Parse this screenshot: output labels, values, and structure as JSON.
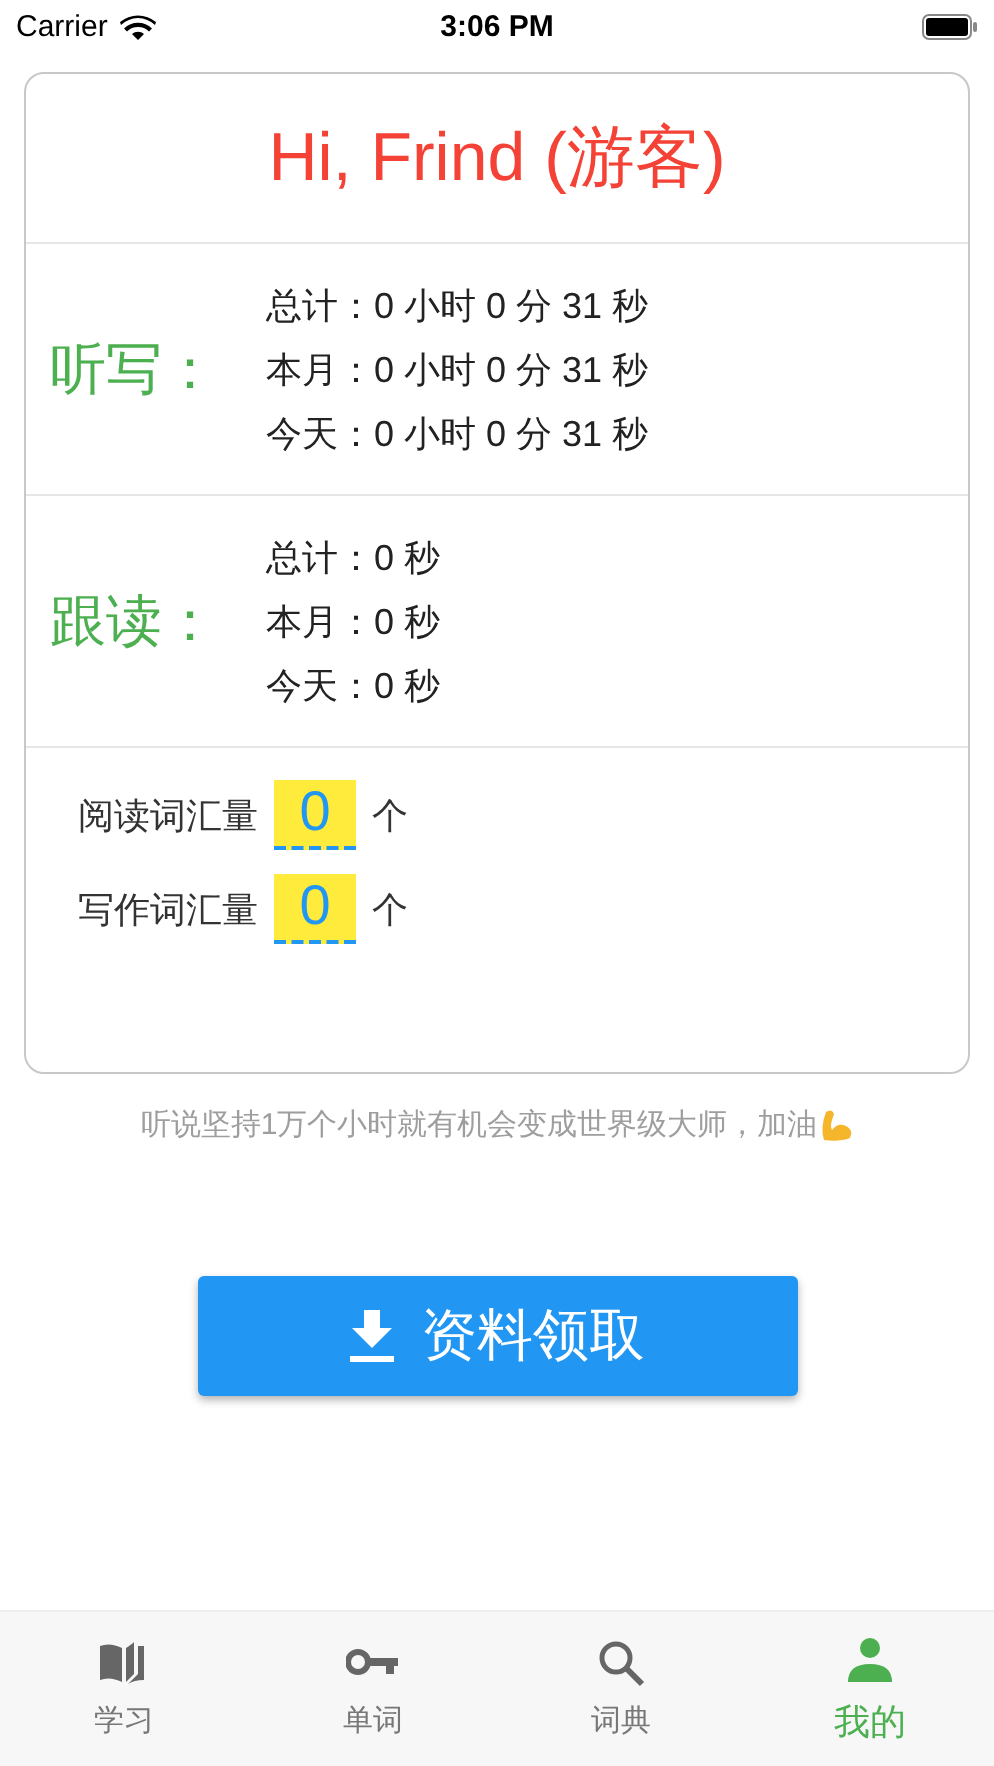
{
  "status_bar": {
    "carrier": "Carrier",
    "time": "3:06 PM"
  },
  "card": {
    "greeting": "Hi, Frind (游客)",
    "sections": [
      {
        "label": "听写：",
        "rows": [
          "总计：0 小时 0 分 31 秒",
          "本月：0 小时 0 分 31 秒",
          "今天：0 小时 0 分 31 秒"
        ]
      },
      {
        "label": "跟读：",
        "rows": [
          "总计：0 秒",
          "本月：0 秒",
          "今天：0 秒"
        ]
      }
    ],
    "vocab": [
      {
        "label": "阅读词汇量",
        "value": "0",
        "unit": "个"
      },
      {
        "label": "写作词汇量",
        "value": "0",
        "unit": "个"
      }
    ]
  },
  "motto": "听说坚持1万个小时就有机会变成世界级大师，加油",
  "download_button": {
    "label": "资料领取"
  },
  "tabs": [
    {
      "label": "学习",
      "selected": false
    },
    {
      "label": "单词",
      "selected": false
    },
    {
      "label": "词典",
      "selected": false
    },
    {
      "label": "我的",
      "selected": true
    }
  ]
}
